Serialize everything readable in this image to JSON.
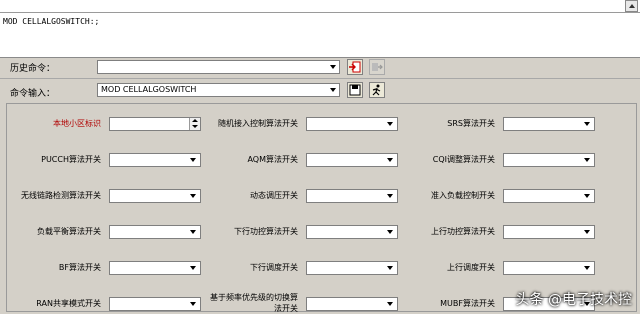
{
  "output": {
    "text": "MOD CELLALGOSWITCH:;"
  },
  "history": {
    "label": "历史命令：",
    "value": ""
  },
  "command": {
    "label": "命令输入：",
    "value": "MOD CELLALGOSWITCH"
  },
  "params": [
    {
      "label": "本地小区标识",
      "required": true,
      "type": "spin"
    },
    {
      "label": "随机接入控制算法开关",
      "type": "select"
    },
    {
      "label": "SRS算法开关",
      "type": "select"
    },
    {
      "label": "PUCCH算法开关",
      "type": "select"
    },
    {
      "label": "AQM算法开关",
      "type": "select"
    },
    {
      "label": "CQI调整算法开关",
      "type": "select"
    },
    {
      "label": "无线链路检测算法开关",
      "type": "select"
    },
    {
      "label": "动态调压开关",
      "type": "select"
    },
    {
      "label": "准入负载控制开关",
      "type": "select"
    },
    {
      "label": "负载平衡算法开关",
      "type": "select"
    },
    {
      "label": "下行功控算法开关",
      "type": "select"
    },
    {
      "label": "上行功控算法开关",
      "type": "select"
    },
    {
      "label": "BF算法开关",
      "type": "select"
    },
    {
      "label": "下行调度开关",
      "type": "select"
    },
    {
      "label": "上行调度开关",
      "type": "select"
    },
    {
      "label": "RAN共享模式开关",
      "type": "select"
    },
    {
      "label": "基于频率优先级的切换算法开关",
      "type": "select"
    },
    {
      "label": "MUBF算法开关",
      "type": "select"
    }
  ],
  "watermark": "头条 @电子技术控",
  "colors": {
    "required_label": "#b00000",
    "background": "#d4d0c8"
  }
}
